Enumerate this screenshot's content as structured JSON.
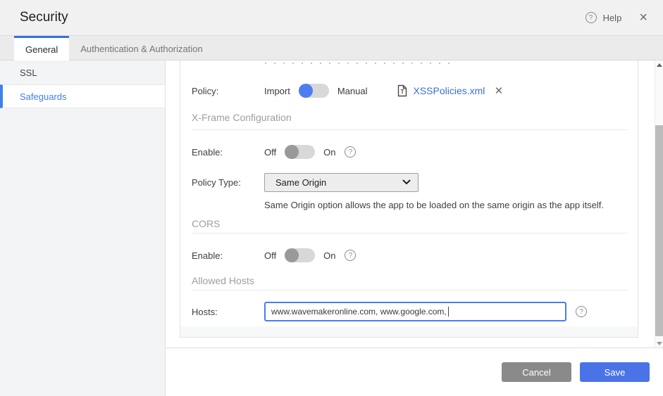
{
  "header": {
    "title": "Security",
    "help_label": "Help"
  },
  "tabs": [
    {
      "label": "General",
      "active": true
    },
    {
      "label": "Authentication & Authorization",
      "active": false
    }
  ],
  "sidebar": {
    "items": [
      {
        "label": "SSL",
        "active": false
      },
      {
        "label": "Safeguards",
        "active": true
      }
    ]
  },
  "content": {
    "policy": {
      "label": "Policy:",
      "toggle_left": "Import",
      "toggle_right": "Manual",
      "toggle_state": "Import",
      "file_name": "XSSPolicies.xml"
    },
    "xframe": {
      "title": "X-Frame Configuration",
      "enable_label": "Enable:",
      "off": "Off",
      "on": "On",
      "enable_state": "Off",
      "policy_type_label": "Policy Type:",
      "policy_type_value": "Same Origin",
      "description": "Same Origin option allows the app to be loaded on the same origin as the app itself."
    },
    "cors": {
      "title": "CORS",
      "enable_label": "Enable:",
      "off": "Off",
      "on": "On",
      "enable_state": "Off"
    },
    "allowed_hosts": {
      "title": "Allowed Hosts",
      "hosts_label": "Hosts:",
      "hosts_value": "www.wavemakeronline.com, www.google.com, "
    }
  },
  "footer": {
    "cancel_label": "Cancel",
    "save_label": "Save"
  },
  "icons": {
    "help": "?",
    "close": "×",
    "remove": "×",
    "xml_file_letter": "T"
  },
  "colors": {
    "accent_blue": "#4d7ef0",
    "link_blue": "#3b6fd6",
    "save_blue": "#4a73e8",
    "cancel_gray": "#8a8a8a",
    "sidebar_active_blue": "#4080e8",
    "tab_active_border": "#3a6fe0"
  }
}
